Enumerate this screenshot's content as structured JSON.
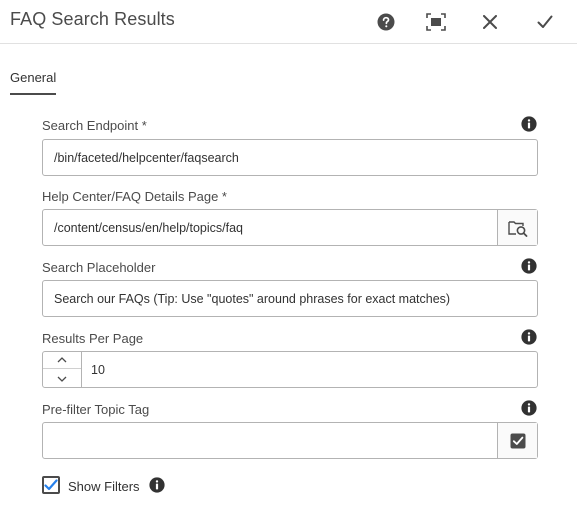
{
  "dialog": {
    "title": "FAQ Search Results",
    "actions": [
      {
        "name": "help-icon"
      },
      {
        "name": "fullscreen-icon"
      },
      {
        "name": "close-icon"
      },
      {
        "name": "done-check-icon"
      }
    ]
  },
  "tabs": [
    {
      "label": "General",
      "active": true
    }
  ],
  "form": {
    "search_endpoint": {
      "label": "Search Endpoint *",
      "value": "/bin/faceted/helpcenter/faqsearch",
      "icon": "info-icon"
    },
    "details_page": {
      "label": "Help Center/FAQ Details Page *",
      "value": "/content/census/en/help/topics/faq",
      "icon": "browse-icon"
    },
    "search_placeholder": {
      "label": "Search Placeholder",
      "value": "Search our FAQs  (Tip: Use \"quotes\" around phrases for exact matches)",
      "icon": "info-icon"
    },
    "results_per_page": {
      "label": "Results Per Page",
      "value": "10",
      "icon": "info-icon"
    },
    "prefilter_tag": {
      "label": "Pre-filter Topic Tag",
      "value": "",
      "icon": "info-icon"
    },
    "show_filters": {
      "label": "Show Filters",
      "checked": true,
      "icon": "info-icon"
    }
  },
  "colors": {
    "accent": "#2680eb",
    "text": "#323232",
    "border": "#b3b3b3"
  }
}
